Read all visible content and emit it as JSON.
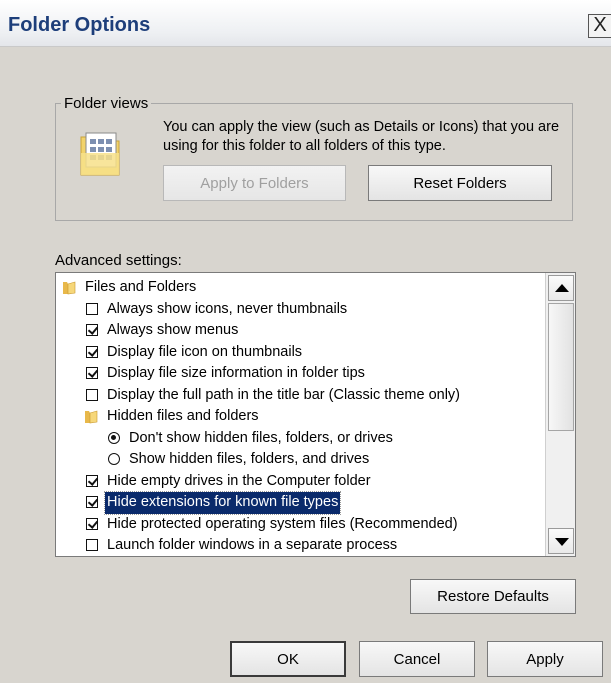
{
  "window": {
    "title": "Folder Options",
    "close_glyph": "X"
  },
  "folder_views": {
    "legend": "Folder views",
    "description": "You can apply the view (such as Details or Icons) that you are using for this folder to all folders of this type.",
    "apply_button": "Apply to Folders",
    "reset_button": "Reset Folders",
    "icon": "folder-view-icon"
  },
  "advanced": {
    "label": "Advanced settings:",
    "items": [
      {
        "type": "folder",
        "indent": 0,
        "label": "Files and Folders"
      },
      {
        "type": "checkbox",
        "indent": 1,
        "checked": false,
        "label": "Always show icons, never thumbnails"
      },
      {
        "type": "checkbox",
        "indent": 1,
        "checked": true,
        "label": "Always show menus"
      },
      {
        "type": "checkbox",
        "indent": 1,
        "checked": true,
        "label": "Display file icon on thumbnails"
      },
      {
        "type": "checkbox",
        "indent": 1,
        "checked": true,
        "label": "Display file size information in folder tips"
      },
      {
        "type": "checkbox",
        "indent": 1,
        "checked": false,
        "label": "Display the full path in the title bar (Classic theme only)"
      },
      {
        "type": "folder",
        "indent": 1,
        "label": "Hidden files and folders"
      },
      {
        "type": "radio",
        "indent": 2,
        "checked": true,
        "label": "Don't show hidden files, folders, or drives"
      },
      {
        "type": "radio",
        "indent": 2,
        "checked": false,
        "label": "Show hidden files, folders, and drives"
      },
      {
        "type": "checkbox",
        "indent": 1,
        "checked": true,
        "label": "Hide empty drives in the Computer folder"
      },
      {
        "type": "checkbox",
        "indent": 1,
        "checked": true,
        "label": "Hide extensions for known file types",
        "selected": true
      },
      {
        "type": "checkbox",
        "indent": 1,
        "checked": true,
        "label": "Hide protected operating system files (Recommended)"
      },
      {
        "type": "checkbox",
        "indent": 1,
        "checked": false,
        "label": "Launch folder windows in a separate process"
      }
    ]
  },
  "buttons": {
    "restore_defaults": "Restore Defaults",
    "ok": "OK",
    "cancel": "Cancel",
    "apply": "Apply"
  },
  "colors": {
    "title_text": "#1d3e7a",
    "selection_bg": "#0a2a6b",
    "dialog_bg": "#d8d5cf"
  }
}
